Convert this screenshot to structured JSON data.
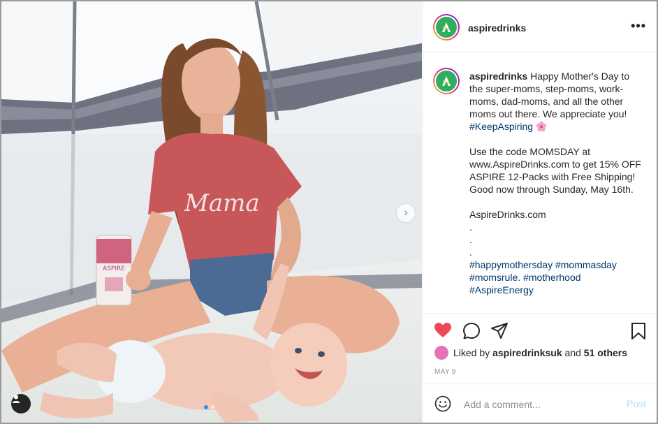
{
  "post": {
    "username": "aspiredrinks",
    "caption_lines": {
      "p1": "Happy Mother's Day to the super-moms, step-moms, work-moms, dad-moms, and all the other moms out there. We appreciate you!",
      "p1_hashtag": "#KeepAspiring",
      "p2": "Use the code MOMSDAY at www.AspireDrinks.com to get 15% OFF ASPIRE 12-Packs with Free Shipping! Good now through Sunday, May 16th.",
      "p3": "AspireDrinks.com",
      "dots": [
        ".",
        ".",
        "."
      ],
      "hashtag1": "#happymothersday",
      "hashtag2": "#mommasday",
      "hashtag3": "#momsrule.",
      "hashtag4": "#motherhood",
      "hashtag5": "#AspireEnergy"
    },
    "likes": {
      "prefix": "Liked by",
      "user": "aspiredrinksuk",
      "and": "and",
      "others": "51 others"
    },
    "date": "MAY 9",
    "comment_placeholder": "Add a comment...",
    "post_label": "Post"
  },
  "icons": {
    "more": "more-options-icon",
    "like": "heart-icon",
    "comment": "comment-icon",
    "share": "paper-plane-icon",
    "save": "bookmark-icon",
    "emoji": "emoji-icon",
    "next": "chevron-right-icon",
    "user_tag": "user-tag-icon"
  },
  "colors": {
    "heart": "#ed4956",
    "hashtag": "#00376b",
    "post_button": "#b2dffc",
    "carousel_active": "#2f8cf0"
  }
}
